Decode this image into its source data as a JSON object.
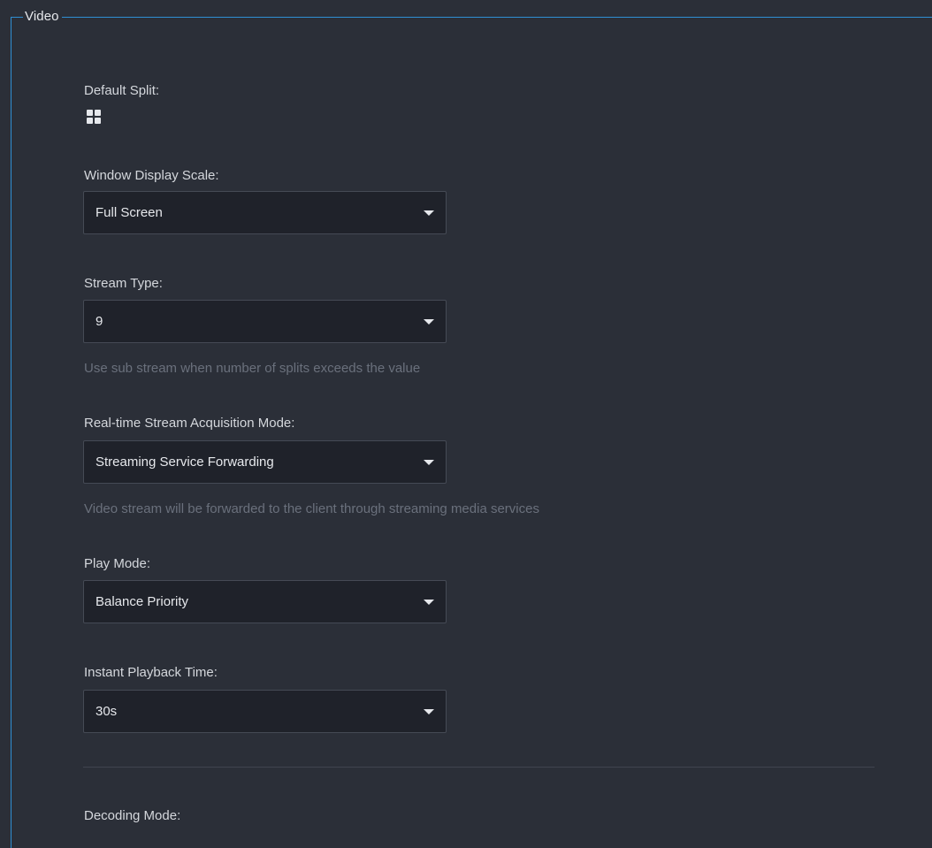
{
  "section": {
    "legend": "Video"
  },
  "default_split": {
    "label": "Default Split:",
    "icon": "split-4-grid-icon"
  },
  "window_display_scale": {
    "label": "Window Display Scale:",
    "value": "Full Screen"
  },
  "stream_type": {
    "label": "Stream Type:",
    "value": "9",
    "hint": "Use sub stream when number of splits exceeds the value"
  },
  "acquisition_mode": {
    "label": "Real-time Stream Acquisition Mode:",
    "value": "Streaming Service Forwarding",
    "hint": "Video stream will be forwarded to the client through streaming media services"
  },
  "play_mode": {
    "label": "Play Mode:",
    "value": "Balance Priority"
  },
  "instant_playback": {
    "label": "Instant Playback Time:",
    "value": "30s"
  },
  "decoding_mode": {
    "label": "Decoding Mode:"
  },
  "colors": {
    "background": "#2b2f38",
    "border_accent": "#2f8fd3",
    "input_bg": "#1f222a",
    "hint_text": "#6a707c"
  }
}
